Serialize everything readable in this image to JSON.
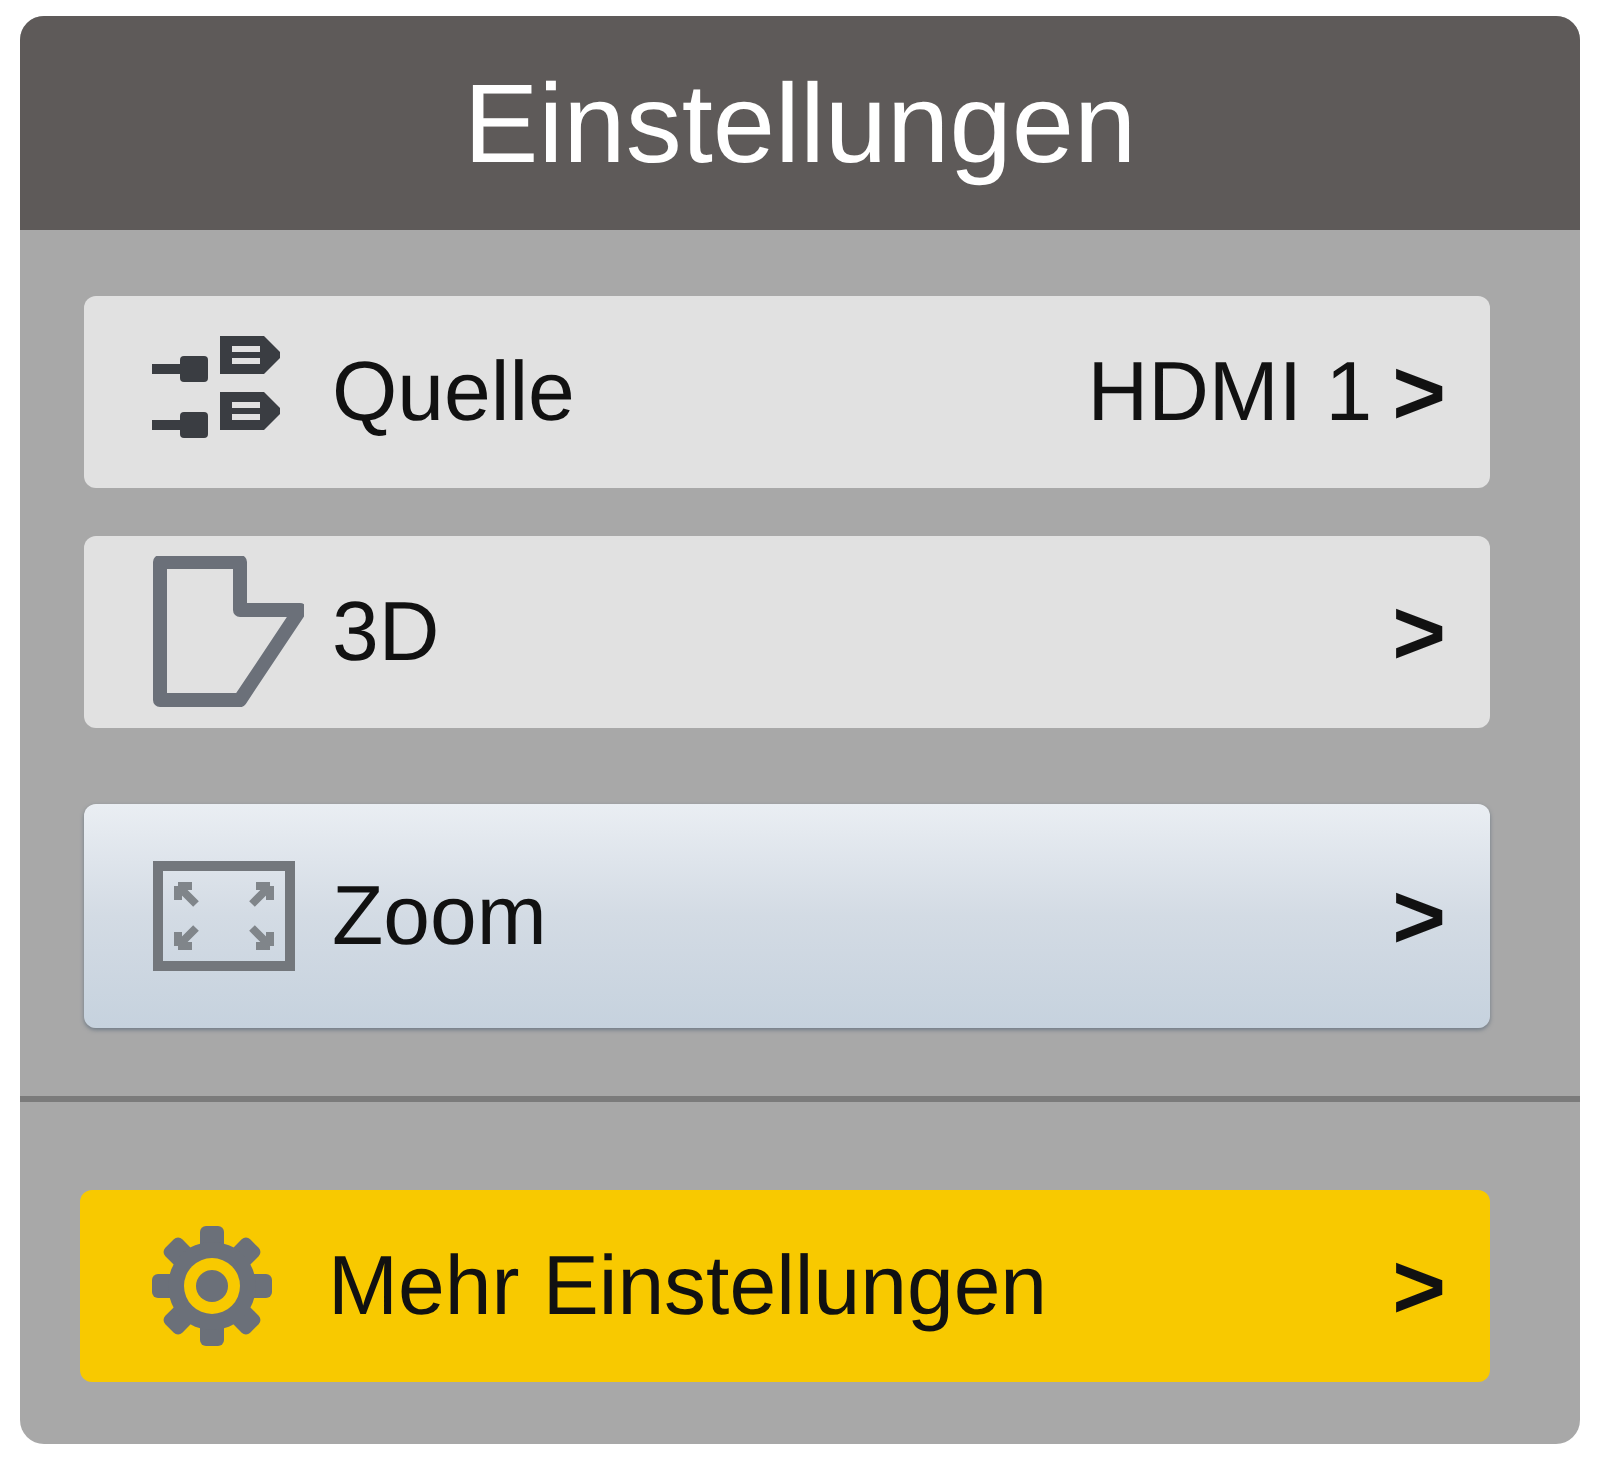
{
  "window": {
    "title": "Einstellungen"
  },
  "sections": [
    {
      "items": [
        {
          "kind": "source",
          "label": "Quelle",
          "value": "HDMI 1",
          "arrow": ">",
          "selected": false,
          "highlighted": false
        },
        {
          "kind": "stereo",
          "label": "3D",
          "arrow": ">",
          "selected": false,
          "highlighted": false
        },
        {
          "kind": "zoom",
          "label": "Zoom",
          "arrow": ">",
          "selected": true,
          "highlighted": false
        }
      ]
    },
    {
      "items": [
        {
          "kind": "settings",
          "label": "Mehr Einstellungen",
          "arrow": ">",
          "selected": false,
          "highlighted": true
        }
      ]
    }
  ]
}
